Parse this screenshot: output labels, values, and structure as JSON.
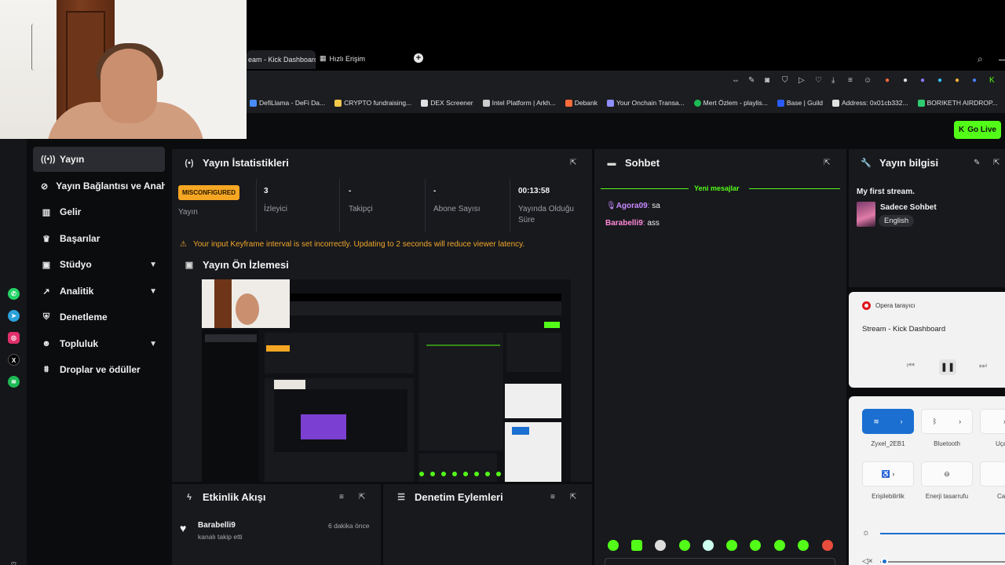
{
  "browser": {
    "active_tab": "eam - Kick Dashboard",
    "quick_tab": "Hızlı Erişim",
    "bookmarks": [
      "DefiLlama - DeFi Da...",
      "CRYPTO fundraising...",
      "DEX Screener",
      "Intel Platform | Arkh...",
      "Debank",
      "Your Onchain Transa...",
      "Mert Özlem - playlis...",
      "Base | Guild",
      "Address: 0x01cb332...",
      "BORIKETH AIRDROP..."
    ]
  },
  "header": {
    "go_live": "Go Live"
  },
  "sidebar": {
    "items": [
      {
        "label": "Yayın",
        "icon": "broadcast-icon"
      },
      {
        "label": "Yayın Bağlantısı ve Anahtarı",
        "icon": "link-icon"
      },
      {
        "label": "Gelir",
        "icon": "chart-icon"
      },
      {
        "label": "Başarılar",
        "icon": "trophy-icon"
      },
      {
        "label": "Stüdyo",
        "icon": "studio-icon"
      },
      {
        "label": "Analitik",
        "icon": "analytics-icon"
      },
      {
        "label": "Denetleme",
        "icon": "shield-icon"
      },
      {
        "label": "Topluluk",
        "icon": "community-icon"
      },
      {
        "label": "Droplar ve ödüller",
        "icon": "gift-icon"
      }
    ]
  },
  "stats": {
    "title": "Yayın İstatistikleri",
    "status_badge": "MISCONFIGURED",
    "status_label": "Yayın",
    "viewers_value": "3",
    "viewers_label": "İzleyici",
    "followers_value": "-",
    "followers_label": "Takipçi",
    "subs_value": "-",
    "subs_label": "Abone Sayısı",
    "uptime_value": "00:13:58",
    "uptime_label": "Yayında Olduğu Süre",
    "warning": "Your input Keyframe interval is set incorrectly. Updating to 2 seconds will reduce viewer latency."
  },
  "preview": {
    "title": "Yayın Ön İzlemesi"
  },
  "activity": {
    "title": "Etkinlik Akışı",
    "user": "Barabelli9",
    "action": "kanalı takip etti",
    "time": "6 dakika önce"
  },
  "moderation": {
    "title": "Denetim Eylemleri"
  },
  "chat": {
    "title": "Sohbet",
    "new_messages": "Yeni mesajlar",
    "messages": [
      {
        "user": "Agora09",
        "text": "sa",
        "color": "#c78bff"
      },
      {
        "user": "Barabelli9",
        "text": "ass",
        "color": "#ff8ad8"
      }
    ]
  },
  "stream_info": {
    "title": "Yayın bilgisi",
    "stream_title": "My first stream.",
    "category": "Sadece Sohbet",
    "language": "English"
  },
  "media": {
    "app": "Opera tarayıcı",
    "track": "Stream - Kick Dashboard"
  },
  "quick_settings": {
    "wifi": "Zyxel_2EB1",
    "bluetooth": "Bluetooth",
    "airplane": "Uçak",
    "accessibility": "Erişilebilirlik",
    "energy": "Enerji tasarrufu",
    "live": "Canlı"
  },
  "colors": {
    "accent": "#53fc18",
    "warning": "#f5a623",
    "panel": "#18191d"
  }
}
